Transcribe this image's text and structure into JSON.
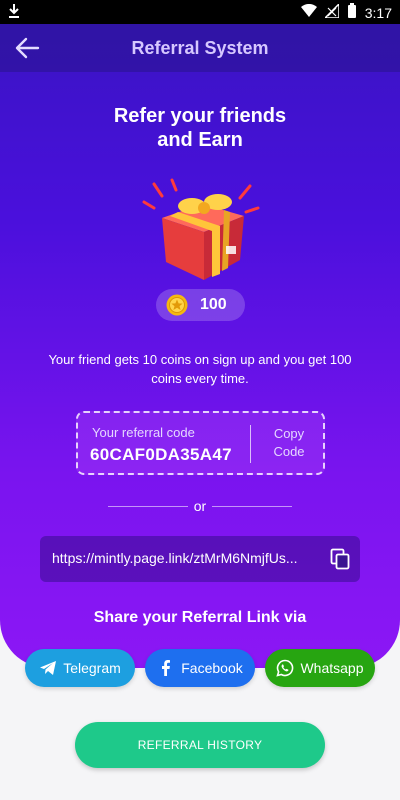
{
  "status_bar": {
    "time": "3:17"
  },
  "header": {
    "title": "Referral System"
  },
  "hero": {
    "headline_line1": "Refer your friends",
    "headline_line2": "and Earn",
    "reward_coins": "100",
    "description": "Your friend gets 10 coins on sign up and you get 100 coins every time."
  },
  "referral": {
    "label": "Your referral code",
    "code": "60CAF0DA35A47",
    "copy_line1": "Copy",
    "copy_line2": "Code"
  },
  "divider": {
    "text": "or"
  },
  "link": {
    "url": "https://mintly.page.link/ztMrM6NmjfUs..."
  },
  "share": {
    "title": "Share your Referral Link via",
    "buttons": [
      {
        "label": "Telegram",
        "icon": "telegram-icon",
        "color": "#1d9fe0"
      },
      {
        "label": "Facebook",
        "icon": "facebook-icon",
        "color": "#1e6fef"
      },
      {
        "label": "Whatsapp",
        "icon": "whatsapp-icon",
        "color": "#27a511"
      }
    ]
  },
  "history": {
    "label": "REFERRAL HISTORY",
    "color": "#1ec98a"
  },
  "colors": {
    "accent_purple": "#4a10dc",
    "gradient_end": "#8c17f5"
  }
}
